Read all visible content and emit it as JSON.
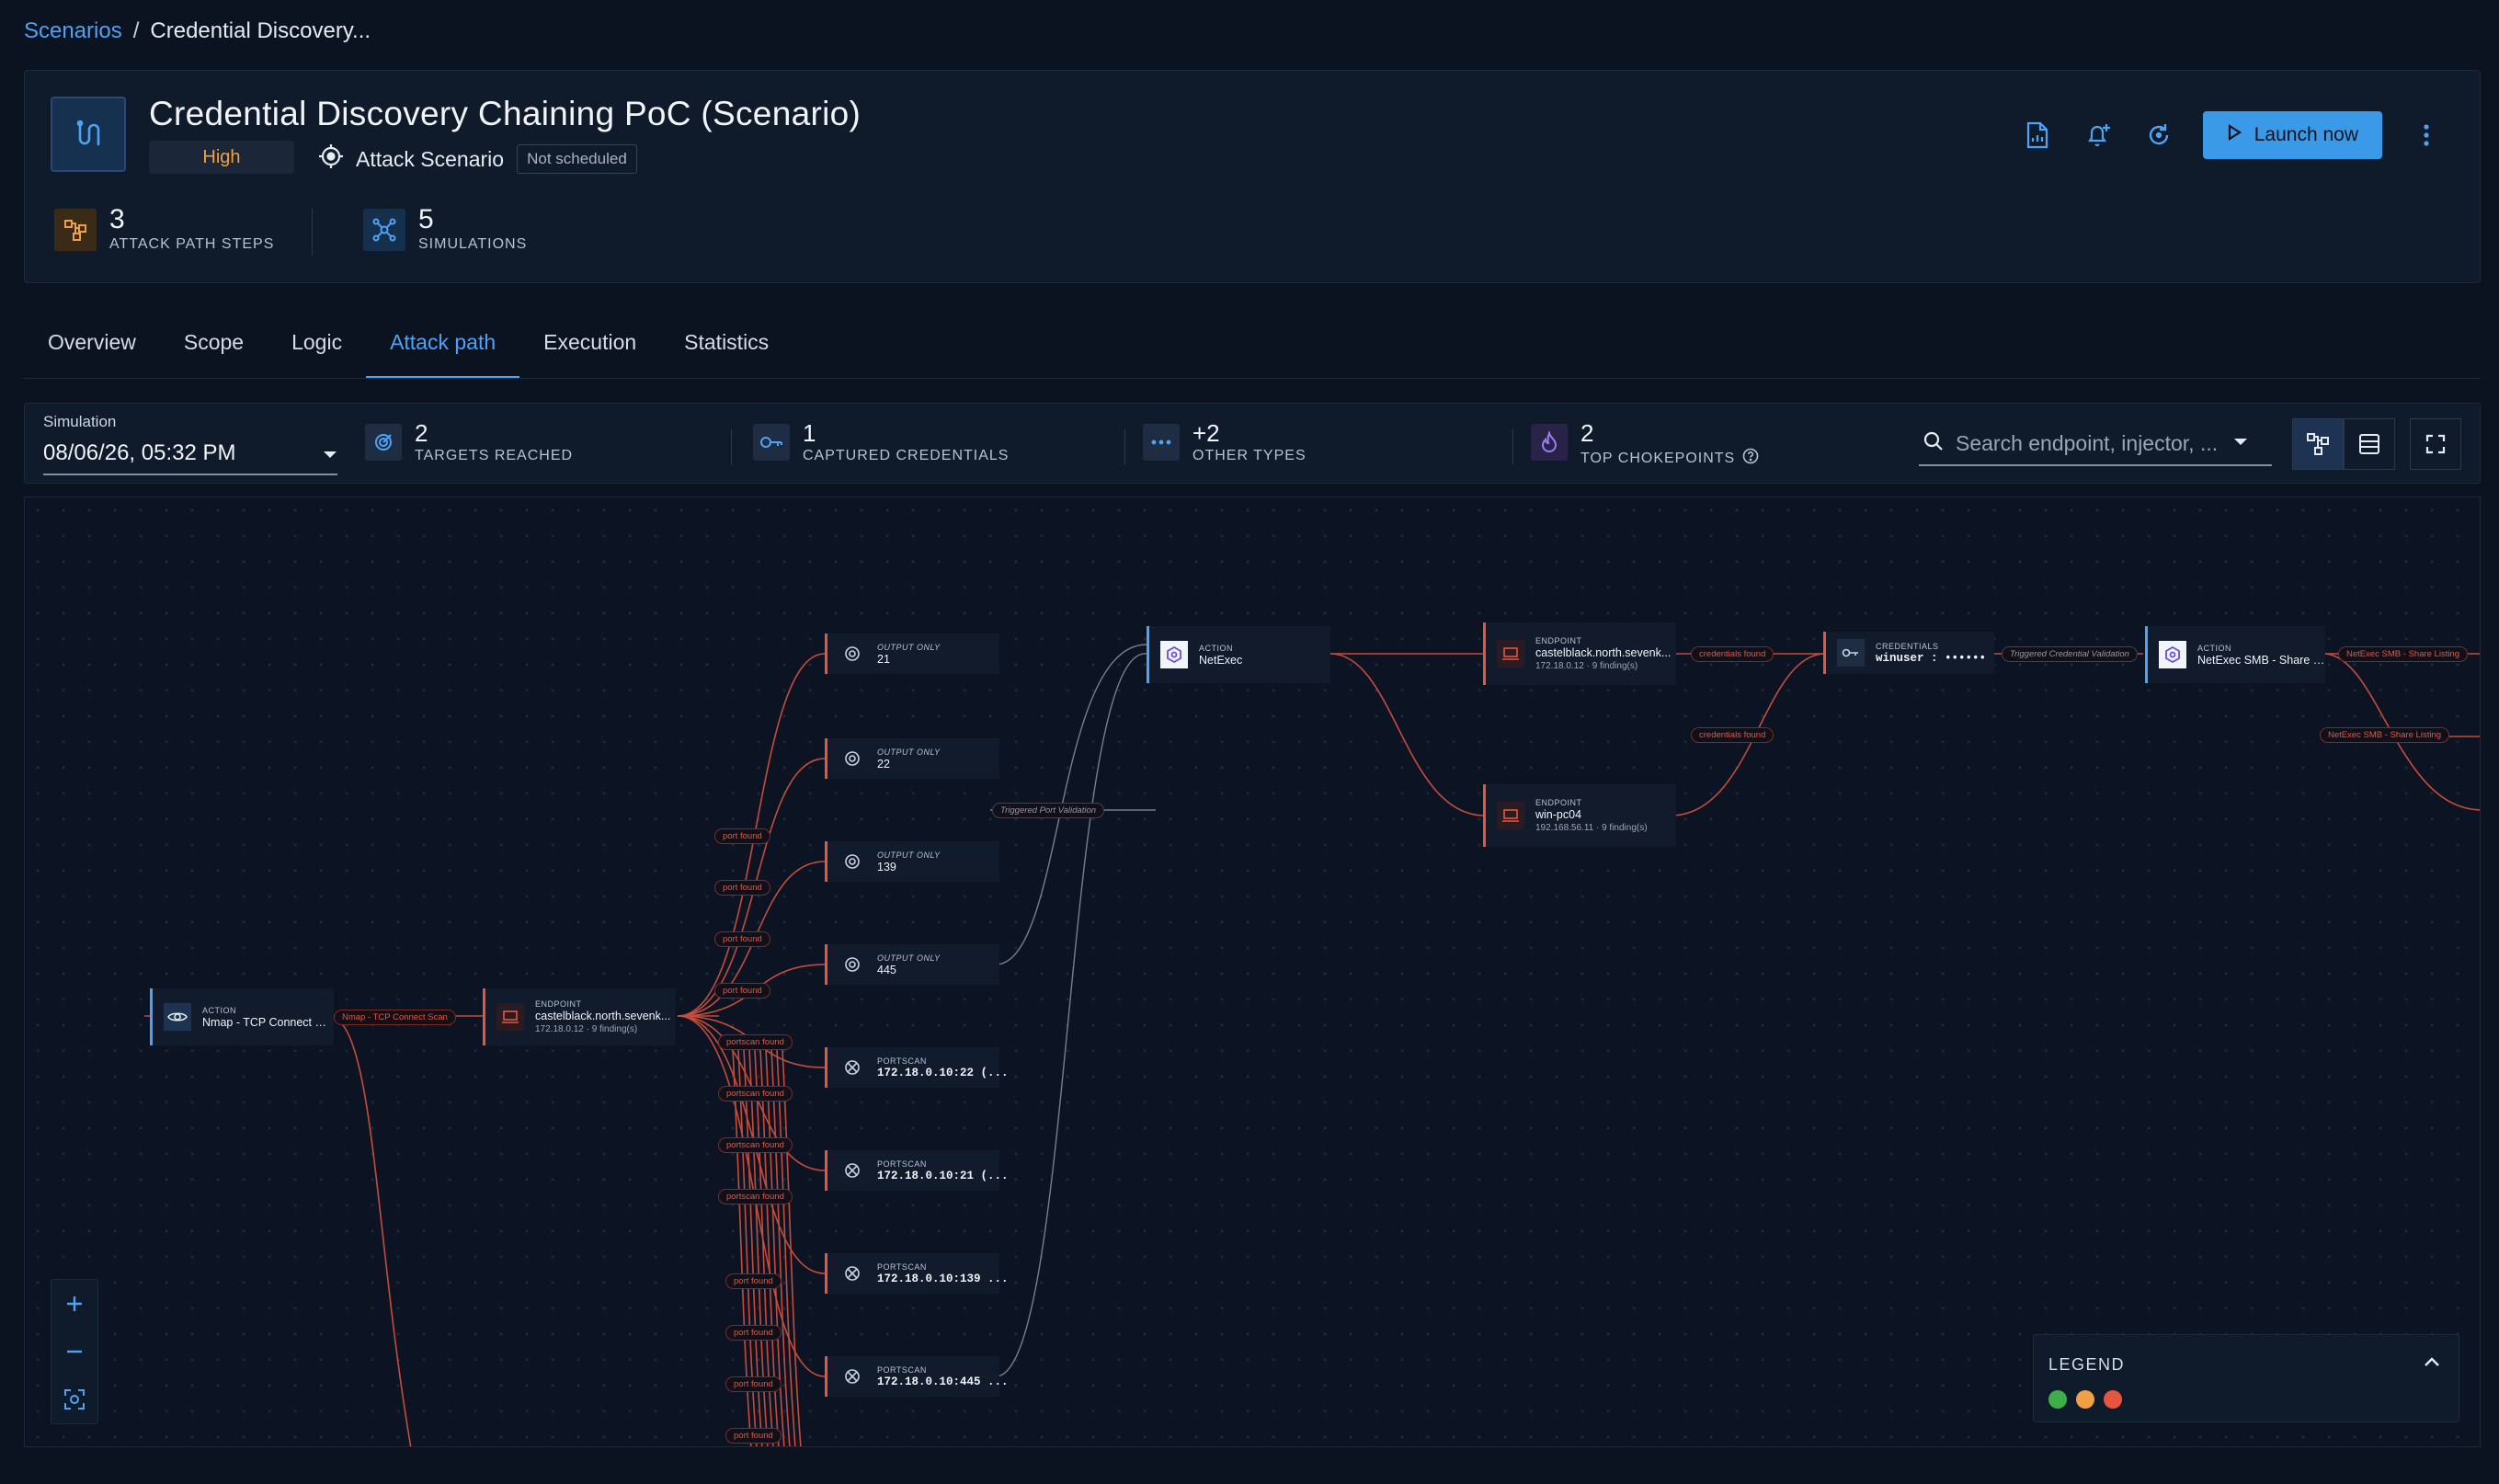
{
  "breadcrumb": {
    "root": "Scenarios",
    "separator": "/",
    "current": "Credential Discovery..."
  },
  "header": {
    "title": "Credential Discovery Chaining PoC (Scenario)",
    "severity": "High",
    "type": "Attack Scenario",
    "schedule": "Not scheduled",
    "kpis": [
      {
        "value": "3",
        "label": "ATTACK PATH STEPS"
      },
      {
        "value": "5",
        "label": "SIMULATIONS"
      }
    ],
    "launch_label": "Launch now"
  },
  "tabs": [
    "Overview",
    "Scope",
    "Logic",
    "Attack path",
    "Execution",
    "Statistics"
  ],
  "active_tab": "Attack path",
  "toolbar": {
    "simulation_label": "Simulation",
    "simulation_value": "08/06/26, 05:32 PM",
    "stats": [
      {
        "value": "2",
        "label": "TARGETS REACHED"
      },
      {
        "value": "1",
        "label": "CAPTURED CREDENTIALS"
      },
      {
        "value": "+2",
        "label": "OTHER TYPES"
      },
      {
        "value": "2",
        "label": "TOP CHOKEPOINTS"
      }
    ],
    "search_placeholder": "Search endpoint, injector, ..."
  },
  "graph": {
    "nodes": {
      "nmap": {
        "kind": "ACTION",
        "name": "Nmap - TCP Connect S..."
      },
      "ep1": {
        "kind": "ENDPOINT",
        "name": "castelblack.north.sevenk...",
        "sub": "172.18.0.12 · 9 finding(s)"
      },
      "out21": {
        "kind": "OUTPUT ONLY",
        "name": "21"
      },
      "out22": {
        "kind": "OUTPUT ONLY",
        "name": "22"
      },
      "out139": {
        "kind": "OUTPUT ONLY",
        "name": "139"
      },
      "out445": {
        "kind": "OUTPUT ONLY",
        "name": "445"
      },
      "ps22": {
        "kind": "PORTSCAN",
        "name": "172.18.0.10:22 (..."
      },
      "ps21": {
        "kind": "PORTSCAN",
        "name": "172.18.0.10:21 (..."
      },
      "ps139": {
        "kind": "PORTSCAN",
        "name": "172.18.0.10:139 ..."
      },
      "ps445": {
        "kind": "PORTSCAN",
        "name": "172.18.0.10:445 ..."
      },
      "netexec": {
        "kind": "ACTION",
        "name": "NetExec"
      },
      "ep2": {
        "kind": "ENDPOINT",
        "name": "castelblack.north.sevenk...",
        "sub": "172.18.0.12 · 9 finding(s)"
      },
      "ep3": {
        "kind": "ENDPOINT",
        "name": "win-pc04",
        "sub": "192.168.56.11 · 9 finding(s)"
      },
      "cred": {
        "kind": "CREDENTIALS",
        "name": "winuser : ••••••"
      },
      "smb": {
        "kind": "ACTION",
        "name": "NetExec SMB - Share Li..."
      }
    },
    "edge_labels": {
      "nmap_scan": "Nmap - TCP Connect Scan",
      "port_found": "port found",
      "portscan_found": "portscan found",
      "triggered_port": "Triggered Port Validation",
      "credentials_found": "credentials found",
      "triggered_cred": "Triggered Credential Validation",
      "smb_listing": "NetExec SMB - Share Listing"
    }
  },
  "legend": {
    "title": "LEGEND",
    "colors": [
      "#3fae49",
      "#f0a044",
      "#e6563f"
    ]
  },
  "colors": {
    "accent": "#4ea3f5",
    "edge": "#e6563f",
    "severity_high": "#f0a044"
  }
}
